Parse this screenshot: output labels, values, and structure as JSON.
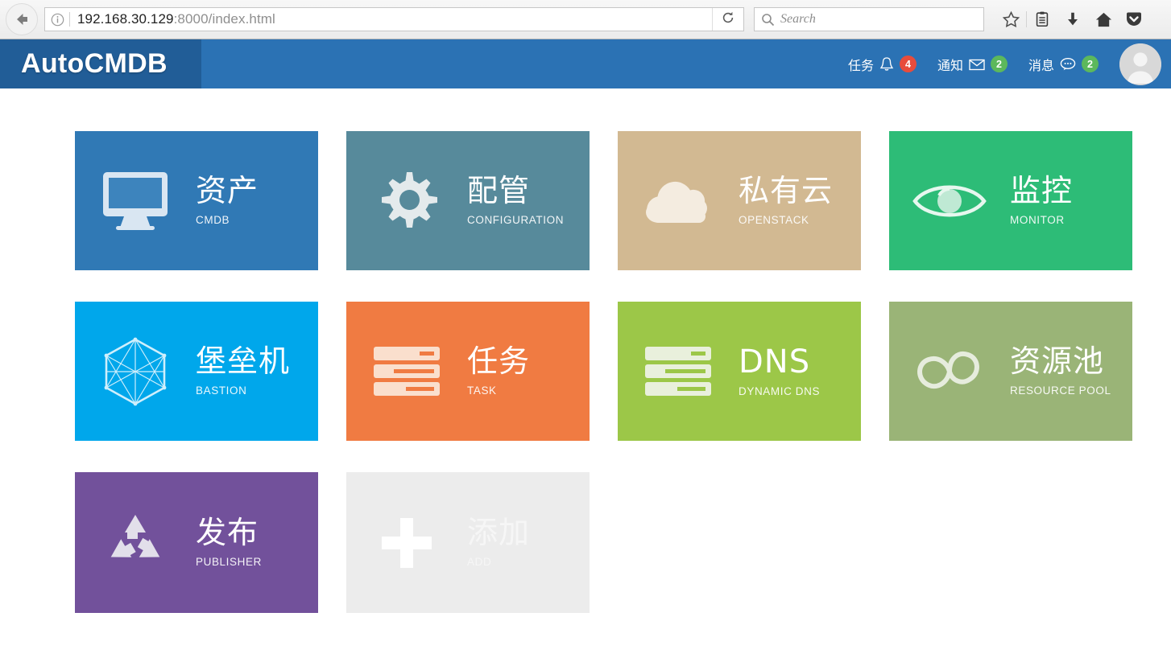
{
  "browser": {
    "back_icon": "back-arrow-icon",
    "identity_icon": "info-icon",
    "url_host": "192.168.30.129",
    "url_rest": ":8000/index.html",
    "reload_icon": "reload-icon",
    "search_placeholder": "Search",
    "search_icon": "search-icon",
    "toolbar_icons": [
      "star-icon",
      "reader-list-icon",
      "download-icon",
      "home-icon",
      "pocket-icon"
    ]
  },
  "header": {
    "brand": "AutoCMDB",
    "brand_bg": "#215d97",
    "bar_bg": "#2b72b4",
    "items": [
      {
        "label": "任务",
        "icon": "bell-icon",
        "count": "4",
        "badge_color": "#e74c3c"
      },
      {
        "label": "通知",
        "icon": "envelope-icon",
        "count": "2",
        "badge_color": "#5cb85c"
      },
      {
        "label": "消息",
        "icon": "chat-bubble-icon",
        "count": "2",
        "badge_color": "#5cb85c"
      }
    ],
    "avatar": "user-avatar"
  },
  "tiles": [
    {
      "cn": "资产",
      "en": "CMDB",
      "icon": "monitor-icon",
      "color": "#3079b5"
    },
    {
      "cn": "配管",
      "en": "CONFIGURATION",
      "icon": "gear-icon",
      "color": "#578a9b"
    },
    {
      "cn": "私有云",
      "en": "OPENSTACK",
      "icon": "cloud-icon",
      "color": "#d2b992"
    },
    {
      "cn": "监控",
      "en": "MONITOR",
      "icon": "eye-icon",
      "color": "#2dbc77"
    },
    {
      "cn": "堡垒机",
      "en": "BASTION",
      "icon": "hexagon-mesh-icon",
      "color": "#00a7eb"
    },
    {
      "cn": "任务",
      "en": "TASK",
      "icon": "task-list-icon",
      "color": "#f07b42"
    },
    {
      "cn": "DNS",
      "en": "DYNAMIC DNS",
      "icon": "server-stack-icon",
      "color": "#9cc748"
    },
    {
      "cn": "资源池",
      "en": "RESOURCE POOL",
      "icon": "infinity-cloud-icon",
      "color": "#9ab477"
    },
    {
      "cn": "发布",
      "en": "PUBLISHER",
      "icon": "recycle-icon",
      "color": "#72519b"
    },
    {
      "cn": "添加",
      "en": "ADD",
      "icon": "plus-icon",
      "color": "#ececec"
    }
  ]
}
